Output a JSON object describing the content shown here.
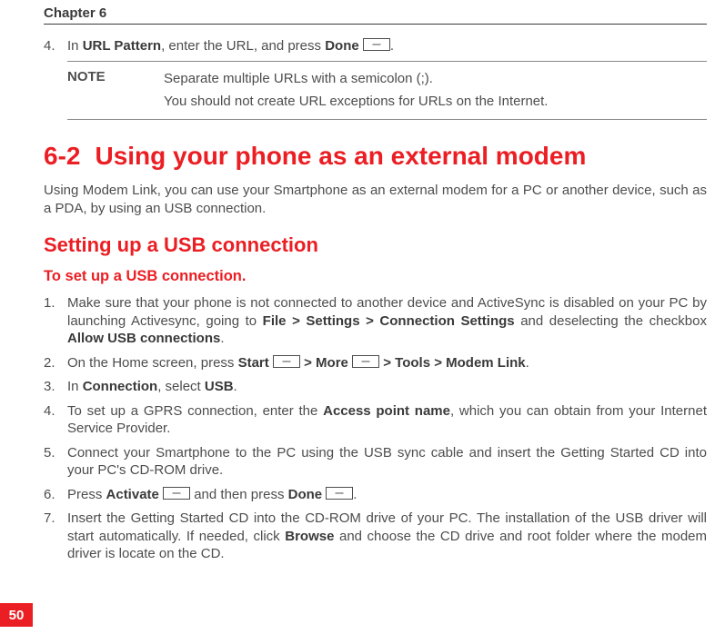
{
  "chapter": "Chapter 6",
  "intro_step": {
    "num": "4.",
    "before": "In ",
    "field": "URL Pattern",
    "mid": ", enter the URL, and press ",
    "done": "Done",
    "after": "."
  },
  "note": {
    "label": "NOTE",
    "line1": "Separate multiple URLs with a semicolon (;).",
    "line2": "You should not create URL exceptions for URLs on the Internet."
  },
  "section": {
    "num": "6-2",
    "title": "Using your phone as an external modem"
  },
  "section_para": "Using Modem Link, you can use your Smartphone as an external modem for a PC or another device, such as a PDA, by using an USB connection.",
  "sub_heading": "Setting up a USB connection",
  "sub_sub": "To set up a USB connection.",
  "steps": {
    "s1": {
      "num": "1.",
      "a": "Make sure that your phone is not connected to another device and ActiveSync is disabled on your PC by launching Activesync, going to ",
      "b": "File > Settings > Connection Settings",
      "c": " and deselecting the checkbox ",
      "d": "Allow USB connections",
      "e": "."
    },
    "s2": {
      "num": "2.",
      "a": "On the Home screen, press ",
      "b": "Start",
      "c": " > More",
      "d": " > Tools > Modem Link",
      "e": "."
    },
    "s3": {
      "num": "3.",
      "a": "In ",
      "b": "Connection",
      "c": ", select ",
      "d": "USB",
      "e": "."
    },
    "s4": {
      "num": "4.",
      "a": "To set up a GPRS connection, enter the ",
      "b": "Access point name",
      "c": ", which you can obtain from your Internet Service Provider."
    },
    "s5": {
      "num": "5.",
      "a": "Connect your Smartphone to the PC using the USB sync cable and insert the Getting Started CD into your PC's CD-ROM drive."
    },
    "s6": {
      "num": "6.",
      "a": "Press ",
      "b": "Activate",
      "c": " and then press ",
      "d": "Done",
      "e": "."
    },
    "s7": {
      "num": "7.",
      "a": "Insert the Getting Started CD into the CD-ROM drive of your PC. The installation of the USB driver will start automatically. If needed, click ",
      "b": "Browse",
      "c": " and choose the CD drive and root folder where the modem driver is locate on the CD."
    }
  },
  "page_number": "50"
}
